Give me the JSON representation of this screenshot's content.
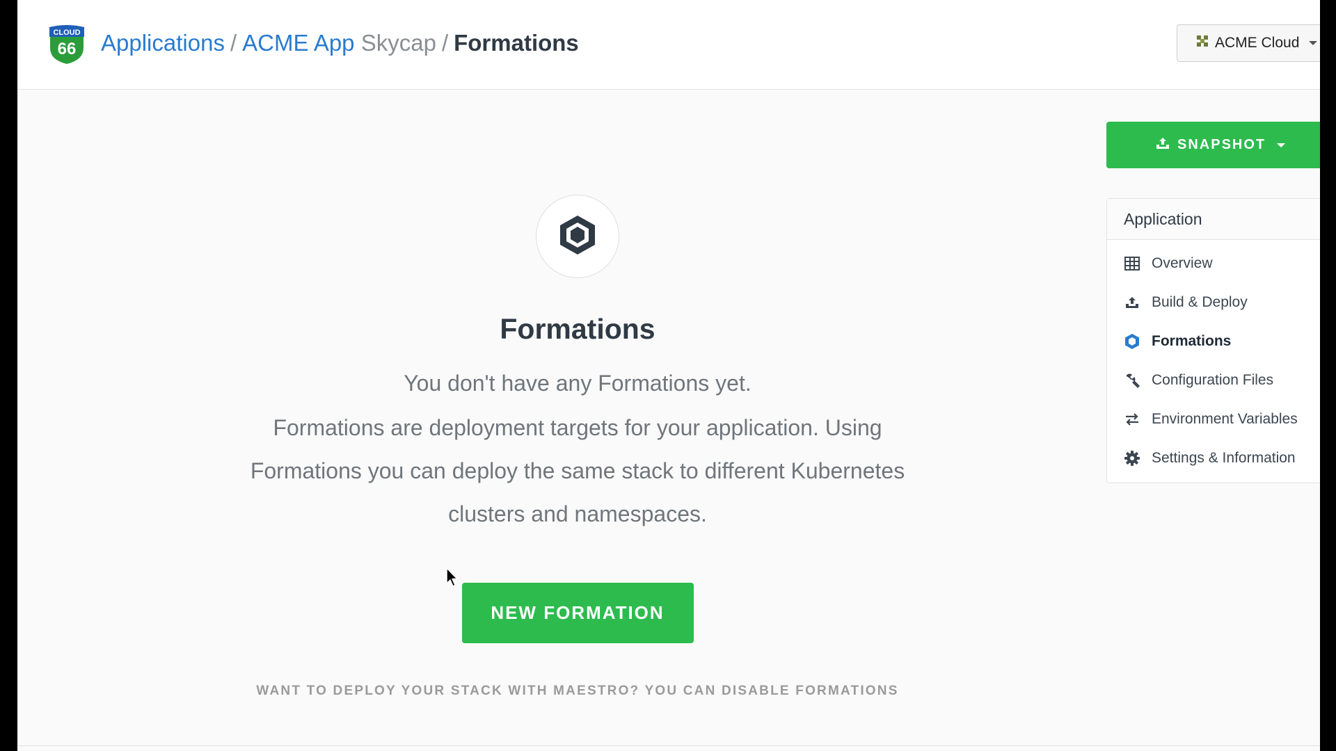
{
  "logo": {
    "top_text": "CLOUD",
    "number": "66",
    "colors": {
      "top": "#1f5fb8",
      "bottom": "#2a9d3a"
    }
  },
  "breadcrumb": {
    "applications": "Applications",
    "sep1": "/",
    "app": "ACME App",
    "product": "Skycap",
    "sep2": "/",
    "current": "Formations"
  },
  "org": {
    "label": "ACME Cloud",
    "icon": "org-icon"
  },
  "snapshot": {
    "label": "SNAPSHOT",
    "icon": "upload-tray-icon"
  },
  "sidebar": {
    "header": "Application",
    "items": [
      {
        "label": "Overview",
        "icon": "table-icon"
      },
      {
        "label": "Build & Deploy",
        "icon": "upload-tray-icon"
      },
      {
        "label": "Formations",
        "icon": "hexagon-icon",
        "active": true
      },
      {
        "label": "Configuration Files",
        "icon": "wrench-icon"
      },
      {
        "label": "Environment Variables",
        "icon": "swap-arrows-icon"
      },
      {
        "label": "Settings & Information",
        "icon": "gear-icon"
      }
    ]
  },
  "main": {
    "icon": "hexagon-icon",
    "title": "Formations",
    "empty": "You don't have any Formations yet.",
    "description": "Formations are deployment targets for your application. Using Formations you can deploy the same stack to different Kubernetes clusters and namespaces.",
    "new_button": "NEW FORMATION",
    "disable_link": "WANT TO DEPLOY YOUR STACK WITH MAESTRO? YOU CAN DISABLE FORMATIONS"
  },
  "colors": {
    "accent_green": "#2dbb4e",
    "link_blue": "#2a7bcf",
    "active_icon_blue": "#2a7bcf"
  }
}
